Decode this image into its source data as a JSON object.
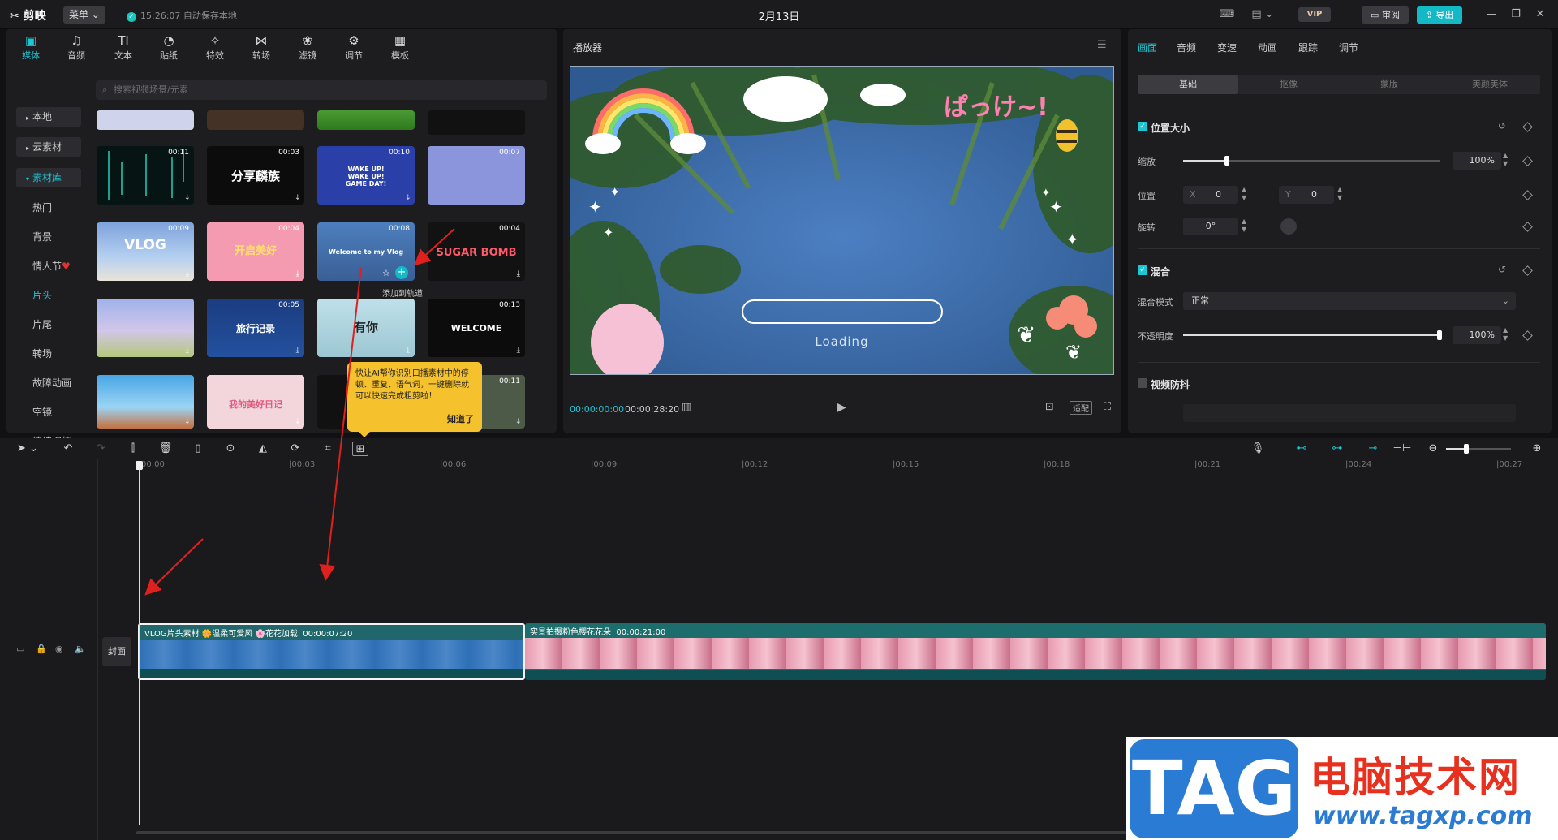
{
  "app": {
    "logo": "剪映",
    "menu": "菜单",
    "autosave": "15:26:07 自动保存本地",
    "title": "2月13日",
    "vip": "VIP",
    "review": "审阅",
    "export": "导出"
  },
  "media_tabs": [
    {
      "label": "媒体",
      "icon": "media-icon"
    },
    {
      "label": "音频",
      "icon": "audio-icon"
    },
    {
      "label": "文本",
      "icon": "text-icon"
    },
    {
      "label": "贴纸",
      "icon": "sticker-icon"
    },
    {
      "label": "特效",
      "icon": "effects-icon"
    },
    {
      "label": "转场",
      "icon": "transition-icon"
    },
    {
      "label": "滤镜",
      "icon": "filter-icon"
    },
    {
      "label": "调节",
      "icon": "adjust-icon"
    },
    {
      "label": "模板",
      "icon": "template-icon"
    }
  ],
  "sidebar": {
    "local": "本地",
    "cloud": "云素材",
    "library": "素材库",
    "items": [
      "热门",
      "背景",
      "情人节",
      "片头",
      "片尾",
      "转场",
      "故障动画",
      "空镜",
      "情绪爆梗"
    ]
  },
  "search_placeholder": "搜索视频场景/元素",
  "thumbs": [
    {
      "dur": "00:11",
      "text": ""
    },
    {
      "dur": "00:03",
      "text": "分享麟族"
    },
    {
      "dur": "00:10",
      "text": "WAKE UP! WAKE UP! GAME DAY!"
    },
    {
      "dur": "00:07",
      "text": ""
    },
    {
      "dur": "00:09",
      "text": "VLOG"
    },
    {
      "dur": "00:04",
      "text": "开启美好"
    },
    {
      "dur": "00:08",
      "text": "Welcome to my Vlog"
    },
    {
      "dur": "00:04",
      "text": "SUGAR BOMB"
    },
    {
      "dur": "",
      "text": ""
    },
    {
      "dur": "00:05",
      "text": "旅行记录"
    },
    {
      "dur": "",
      "text": "有你"
    },
    {
      "dur": "00:13",
      "text": "WELCOME"
    },
    {
      "dur": "",
      "text": ""
    },
    {
      "dur": "",
      "text": "我的美好日记"
    },
    {
      "dur": "",
      "text": ""
    },
    {
      "dur": "00:11",
      "text": ""
    }
  ],
  "add_hint": "添加到轨道",
  "tooltip": {
    "text": "快让AI帮你识别口播素材中的停顿、重复、语气词，一键删除就可以快速完成粗剪啦！",
    "button": "知道了"
  },
  "player": {
    "title": "播放器",
    "loading": "Loading",
    "overlay_text": "ぱっけ~!",
    "current": "00:00:00:00",
    "total": "00:00:28:20",
    "ratio": "适配"
  },
  "right_tabs": [
    "画面",
    "音频",
    "变速",
    "动画",
    "跟踪",
    "调节"
  ],
  "sub_tabs": [
    "基础",
    "抠像",
    "蒙版",
    "美颜美体"
  ],
  "props": {
    "pos_size": "位置大小",
    "scale_label": "缩放",
    "scale_value": "100%",
    "scale_level": 1.0,
    "position_label": "位置",
    "x_label": "X",
    "x_value": "0",
    "y_label": "Y",
    "y_value": "0",
    "rotate_label": "旋转",
    "rotate_value": "0°",
    "blend": "混合",
    "blend_mode_label": "混合模式",
    "blend_mode_value": "正常",
    "opacity_label": "不透明度",
    "opacity_value": "100%",
    "opacity_level": 1.0,
    "stabilize": "视频防抖"
  },
  "ruler": [
    "00:00",
    "|00:03",
    "|00:06",
    "|00:09",
    "|00:12",
    "|00:15",
    "|00:18",
    "|00:21",
    "|00:24",
    "|00:27"
  ],
  "track": {
    "cover": "封面",
    "clip1_label": "VLOG片头素材 🌼温柔可爱风 🌸花花加载",
    "clip1_dur": "00:00:07:20",
    "clip2_label": "实景拍摄粉色樱花花朵",
    "clip2_dur": "00:00:21:00"
  },
  "watermark": {
    "tag": "TAG",
    "cn": "电脑技术网",
    "url": "www.tagxp.com"
  },
  "colors": {
    "accent": "#1ec6d3",
    "tooltip": "#f5c12c",
    "arrow": "#e0201e",
    "export": "#15b8c5"
  }
}
